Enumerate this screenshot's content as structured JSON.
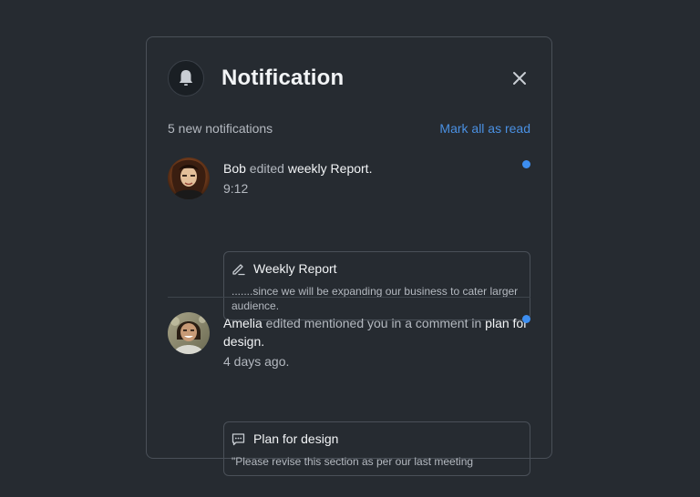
{
  "header": {
    "title": "Notification",
    "icon": "bell-icon",
    "close_icon": "close-icon"
  },
  "subbar": {
    "count_text": "5 new notifications",
    "mark_all_label": "Mark all as read"
  },
  "notifications": [
    {
      "actor": "Bob",
      "action": " edited ",
      "target": "weekly Report.",
      "time": "9:12",
      "unread": true,
      "card_icon": "pencil-icon",
      "card_title": "Weekly Report",
      "card_body": ".......since we will be expanding our business to cater larger audience."
    },
    {
      "actor": "Amelia",
      "action": " edited mentioned you in a comment in ",
      "target": "plan for design.",
      "time": "4 days ago.",
      "unread": true,
      "card_icon": "comment-icon",
      "card_title": "Plan for design",
      "card_body": "\"Please revise this section as per our last meeting"
    }
  ],
  "colors": {
    "background": "#262b31",
    "accent": "#4a90e2",
    "unread_dot": "#3d8ef0"
  }
}
